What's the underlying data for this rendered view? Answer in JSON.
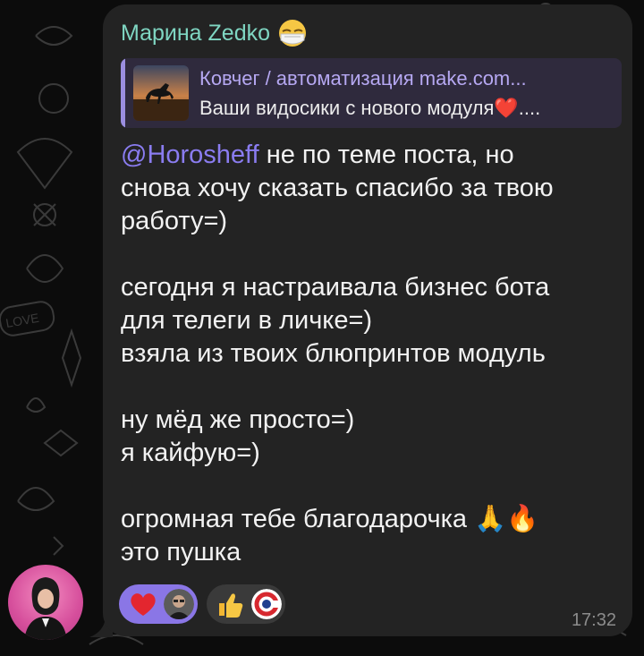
{
  "message": {
    "sender_name": "Марина Zedko",
    "sender_emoji_icon": "mask-face-emoji-icon",
    "reply": {
      "title": "Ковчег / автоматизация make.com...",
      "text": "Ваши видосики с нового модуля❤️...."
    },
    "mention": "@Horosheff",
    "paragraphs": [
      [
        " не по теме поста, но",
        "снова хочу сказать спасибо за твою",
        "работу=)"
      ],
      [
        "сегодня я настраивала бизнес бота",
        "для телеги в личке=)",
        "взяла из твоих блюпринтов модуль"
      ],
      [
        "ну мёд же просто=)",
        "я кайфую=)"
      ],
      [
        "огромная тебе благодарочка 🙏🔥",
        "это пушка"
      ]
    ],
    "time": "17:32"
  },
  "reactions": [
    {
      "emoji": "❤️",
      "icon": "heart-reaction-icon",
      "selected": true,
      "user_avatar_icon": "user-avatar-icon"
    },
    {
      "emoji": "👍",
      "icon": "thumbs-up-reaction-icon",
      "selected": false,
      "user_avatar_icon": "logo-avatar-icon"
    }
  ],
  "colors": {
    "background": "#0c0c0c",
    "bubble": "#232323",
    "sender": "#7fd6c2",
    "mention": "#8a7cf0",
    "reply_accent": "#9b8ee0",
    "reaction_selected": "#8a76e6"
  }
}
